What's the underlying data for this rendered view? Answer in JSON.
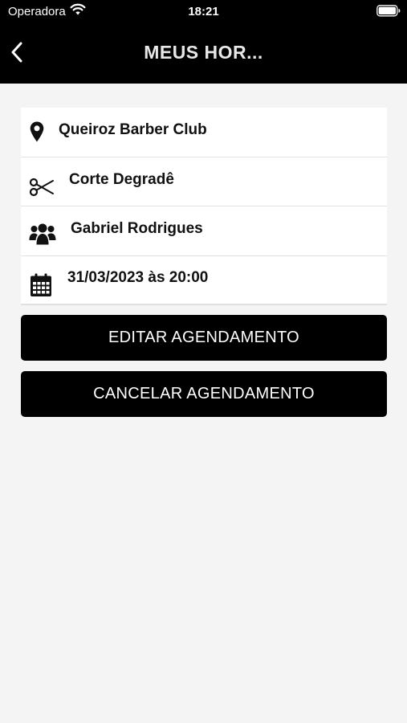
{
  "status_bar": {
    "carrier": "Operadora",
    "time": "18:21",
    "wifi_icon": "wifi-icon",
    "battery_icon": "battery-icon"
  },
  "header": {
    "back_icon": "chevron-left-icon",
    "title": "MEUS HOR..."
  },
  "appointment": {
    "items": [
      {
        "icon": "map-pin-icon",
        "label": "Queiroz Barber Club"
      },
      {
        "icon": "scissors-icon",
        "label": "Corte Degradê"
      },
      {
        "icon": "users-icon",
        "label": "Gabriel Rodrigues"
      },
      {
        "icon": "calendar-icon",
        "label": "31/03/2023 às 20:00"
      }
    ]
  },
  "actions": {
    "edit_label": "EDITAR AGENDAMENTO",
    "cancel_label": "CANCELAR AGENDAMENTO"
  },
  "colors": {
    "bar_background": "#000000",
    "page_background": "#f4f4f4",
    "card_background": "#ffffff",
    "button_background": "#000000",
    "button_text": "#ffffff"
  }
}
